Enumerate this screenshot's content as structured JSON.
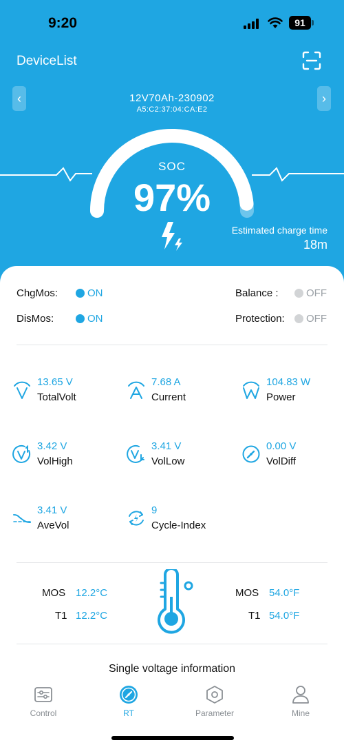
{
  "status_bar": {
    "time": "9:20",
    "battery": "91"
  },
  "header": {
    "title": "DeviceList"
  },
  "device": {
    "name": "12V70Ah-230902",
    "mac": "A5:C2:37:04:CA:E2"
  },
  "soc": {
    "label": "SOC",
    "value": "97%",
    "fraction": 0.97
  },
  "estimate": {
    "label": "Estimated charge time",
    "value": "18m"
  },
  "switches": {
    "chg_mos": {
      "label": "ChgMos:",
      "state": "ON"
    },
    "dis_mos": {
      "label": "DisMos:",
      "state": "ON"
    },
    "balance": {
      "label": "Balance :",
      "state": "OFF"
    },
    "protection": {
      "label": "Protection:",
      "state": "OFF"
    }
  },
  "metrics": [
    {
      "value": "13.65 V",
      "name": "TotalVolt",
      "icon": "total-volt-icon"
    },
    {
      "value": "7.68 A",
      "name": "Current",
      "icon": "current-icon"
    },
    {
      "value": "104.83 W",
      "name": "Power",
      "icon": "power-icon"
    },
    {
      "value": "3.42 V",
      "name": "VolHigh",
      "icon": "vol-high-icon"
    },
    {
      "value": "3.41 V",
      "name": "VolLow",
      "icon": "vol-low-icon"
    },
    {
      "value": "0.00 V",
      "name": "VolDiff",
      "icon": "vol-diff-icon"
    },
    {
      "value": "3.41 V",
      "name": "AveVol",
      "icon": "ave-vol-icon"
    },
    {
      "value": "9",
      "name": "Cycle-Index",
      "icon": "cycle-index-icon"
    }
  ],
  "temperature": {
    "left": [
      {
        "label": "MOS",
        "value": "12.2°C"
      },
      {
        "label": "T1",
        "value": "12.2°C"
      }
    ],
    "right": [
      {
        "label": "MOS",
        "value": "54.0°F"
      },
      {
        "label": "T1",
        "value": "54.0°F"
      }
    ]
  },
  "single_voltage": {
    "title": "Single voltage information"
  },
  "tabs": [
    {
      "label": "Control",
      "icon": "control-icon"
    },
    {
      "label": "RT",
      "icon": "rt-gauge-icon",
      "active": true
    },
    {
      "label": "Parameter",
      "icon": "parameter-hex-icon"
    },
    {
      "label": "Mine",
      "icon": "user-icon"
    }
  ],
  "colors": {
    "accent": "#1fa6e2",
    "off": "#d2d4d6"
  }
}
